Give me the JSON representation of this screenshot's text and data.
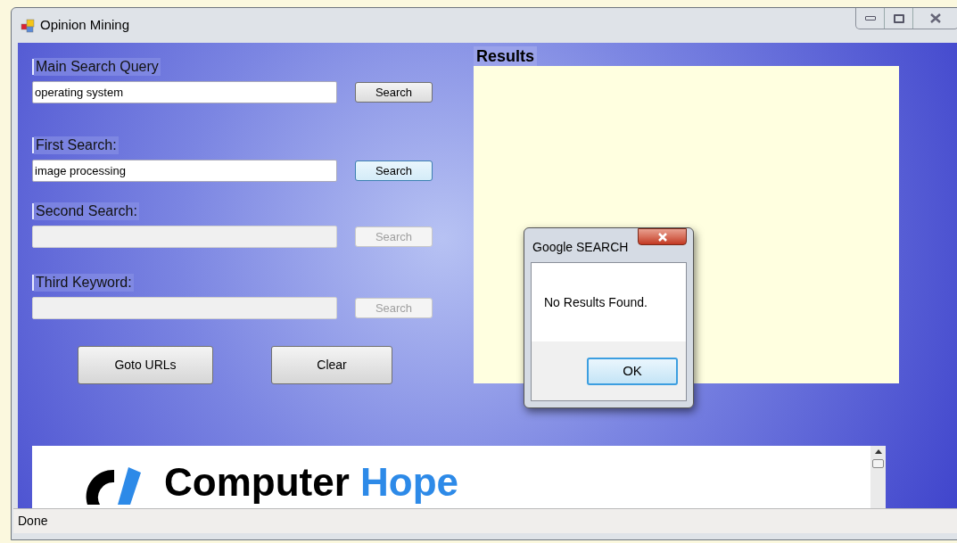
{
  "window": {
    "title": "Opinion Mining"
  },
  "searches": [
    {
      "label": "Main Search Query",
      "value": "operating system",
      "button": "Search",
      "disabled": false,
      "focused": false
    },
    {
      "label": "First Search:",
      "value": "image processing",
      "button": "Search",
      "disabled": false,
      "focused": true
    },
    {
      "label": "Second Search:",
      "button": "Search",
      "disabled": true,
      "focused": false
    },
    {
      "label": "Third Keyword:",
      "button": "Search",
      "disabled": true,
      "focused": false
    }
  ],
  "actions": [
    "Goto URLs",
    "Clear"
  ],
  "results": {
    "label": "Results"
  },
  "browser": {
    "logo_text": "Computer",
    "logo_accent": "Hope"
  },
  "dialog": {
    "title": "Google SEARCH",
    "message": "No Results Found.",
    "button": "OK"
  },
  "status_bar": {
    "text": "Done"
  }
}
